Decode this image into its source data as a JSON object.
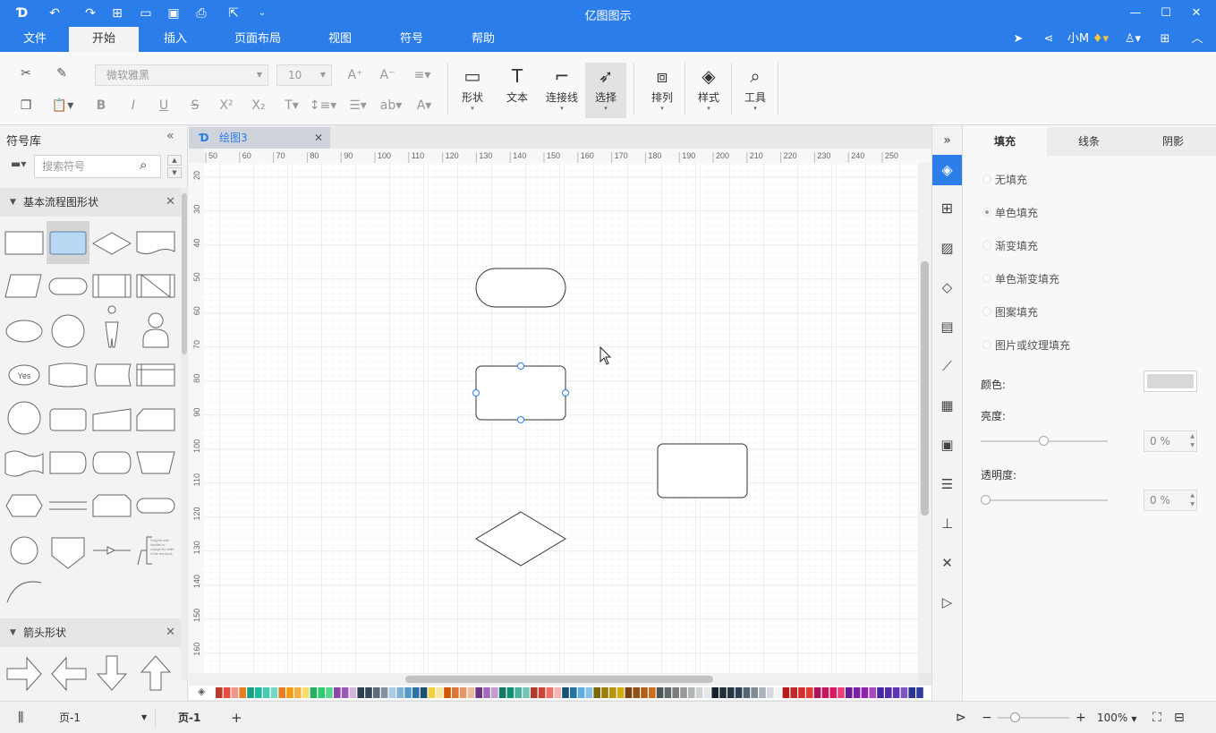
{
  "app": {
    "title": "亿图图示"
  },
  "quick_access": [
    {
      "icon": "app-logo-icon",
      "glyph": "D"
    },
    {
      "icon": "undo-icon",
      "glyph": "↶"
    },
    {
      "icon": "redo-icon",
      "glyph": "↷"
    },
    {
      "icon": "new-icon",
      "glyph": "⊞"
    },
    {
      "icon": "open-folder-icon",
      "glyph": "▭"
    },
    {
      "icon": "save-icon",
      "glyph": "▣"
    },
    {
      "icon": "print-icon",
      "glyph": "⎙"
    },
    {
      "icon": "export-icon",
      "glyph": "⇱"
    },
    {
      "icon": "customize-icon",
      "glyph": "⌄"
    }
  ],
  "window_controls": [
    "—",
    "☐",
    "✕"
  ],
  "menu": {
    "items": [
      "文件",
      "开始",
      "插入",
      "页面布局",
      "视图",
      "符号",
      "帮助"
    ],
    "active": "开始",
    "user": "小M"
  },
  "ribbon": {
    "font_name": "微软雅黑",
    "font_size": "10",
    "big_buttons": [
      "形状",
      "文本",
      "连接线",
      "选择",
      "排列",
      "样式",
      "工具"
    ],
    "active_button": "选择"
  },
  "library": {
    "title": "符号库",
    "search_placeholder": "搜索符号",
    "sections": [
      {
        "name": "基本流程图形状"
      },
      {
        "name": "箭头形状"
      }
    ],
    "yes_label": "Yes"
  },
  "document": {
    "tab_name": "绘图3",
    "ruler_h": [
      "50",
      "60",
      "70",
      "80",
      "90",
      "100",
      "110",
      "120",
      "130",
      "140",
      "150",
      "160",
      "170",
      "180",
      "190",
      "200",
      "210",
      "220",
      "230",
      "240",
      "250"
    ],
    "ruler_v": [
      "20",
      "30",
      "40",
      "50",
      "60",
      "70",
      "80",
      "90",
      "100",
      "110",
      "120",
      "130",
      "140",
      "150",
      "160"
    ]
  },
  "properties": {
    "tabs": [
      "填充",
      "线条",
      "阴影"
    ],
    "active_tab": "填充",
    "fill_options": [
      "无填充",
      "单色填充",
      "渐变填充",
      "单色渐变填充",
      "图案填充",
      "图片或纹理填充"
    ],
    "selected_fill": "单色填充",
    "color_label": "颜色:",
    "color_value": "#d9d9d9",
    "brightness_label": "亮度:",
    "brightness_value": "0 %",
    "brightness_level": 0.5,
    "transparency_label": "透明度:",
    "transparency_value": "0 %",
    "transparency_level": 0
  },
  "status": {
    "page_select": "页-1",
    "page_tab": "页-1",
    "zoom": "100%"
  },
  "accent_color": "#2b7de9"
}
